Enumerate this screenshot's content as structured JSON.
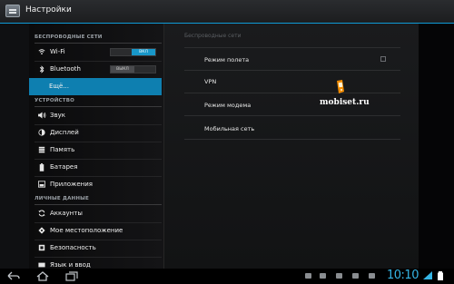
{
  "app": {
    "title": "Настройки",
    "icon": "settings-sliders-icon"
  },
  "sidebar": {
    "sections": [
      {
        "label": "БЕСПРОВОДНЫЕ СЕТИ"
      },
      {
        "label": "УСТРОЙСТВО"
      },
      {
        "label": "ЛИЧНЫЕ ДАННЫЕ"
      }
    ],
    "items": [
      {
        "label": "Wi-Fi",
        "icon": "wifi-icon",
        "toggle": "ВКЛ"
      },
      {
        "label": "Bluetooth",
        "icon": "bluetooth-icon",
        "toggle": "ВЫКЛ"
      },
      {
        "label": "Ещё...",
        "selected": true
      },
      {
        "label": "Звук",
        "icon": "speaker-icon"
      },
      {
        "label": "Дисплей",
        "icon": "display-icon"
      },
      {
        "label": "Память",
        "icon": "storage-icon"
      },
      {
        "label": "Батарея",
        "icon": "battery-icon"
      },
      {
        "label": "Приложения",
        "icon": "apps-icon"
      },
      {
        "label": "Аккаунты",
        "icon": "sync-icon"
      },
      {
        "label": "Мое местоположение",
        "icon": "location-icon"
      },
      {
        "label": "Безопасность",
        "icon": "lock-icon"
      },
      {
        "label": "Язык и ввод",
        "icon": "keyboard-icon"
      }
    ]
  },
  "main": {
    "header": "Беспроводные сети",
    "items": [
      {
        "label": "Режим полета",
        "checked": false
      },
      {
        "label": "VPN"
      },
      {
        "label": "Режим модема"
      },
      {
        "label": "Мобильная сеть"
      }
    ]
  },
  "watermark": {
    "text": "mobiset.ru"
  },
  "statusbar": {
    "time": "10:10"
  },
  "colors": {
    "accent": "#0e7fb0",
    "clock": "#35b5e5",
    "toggle_on": "#1897c9"
  }
}
